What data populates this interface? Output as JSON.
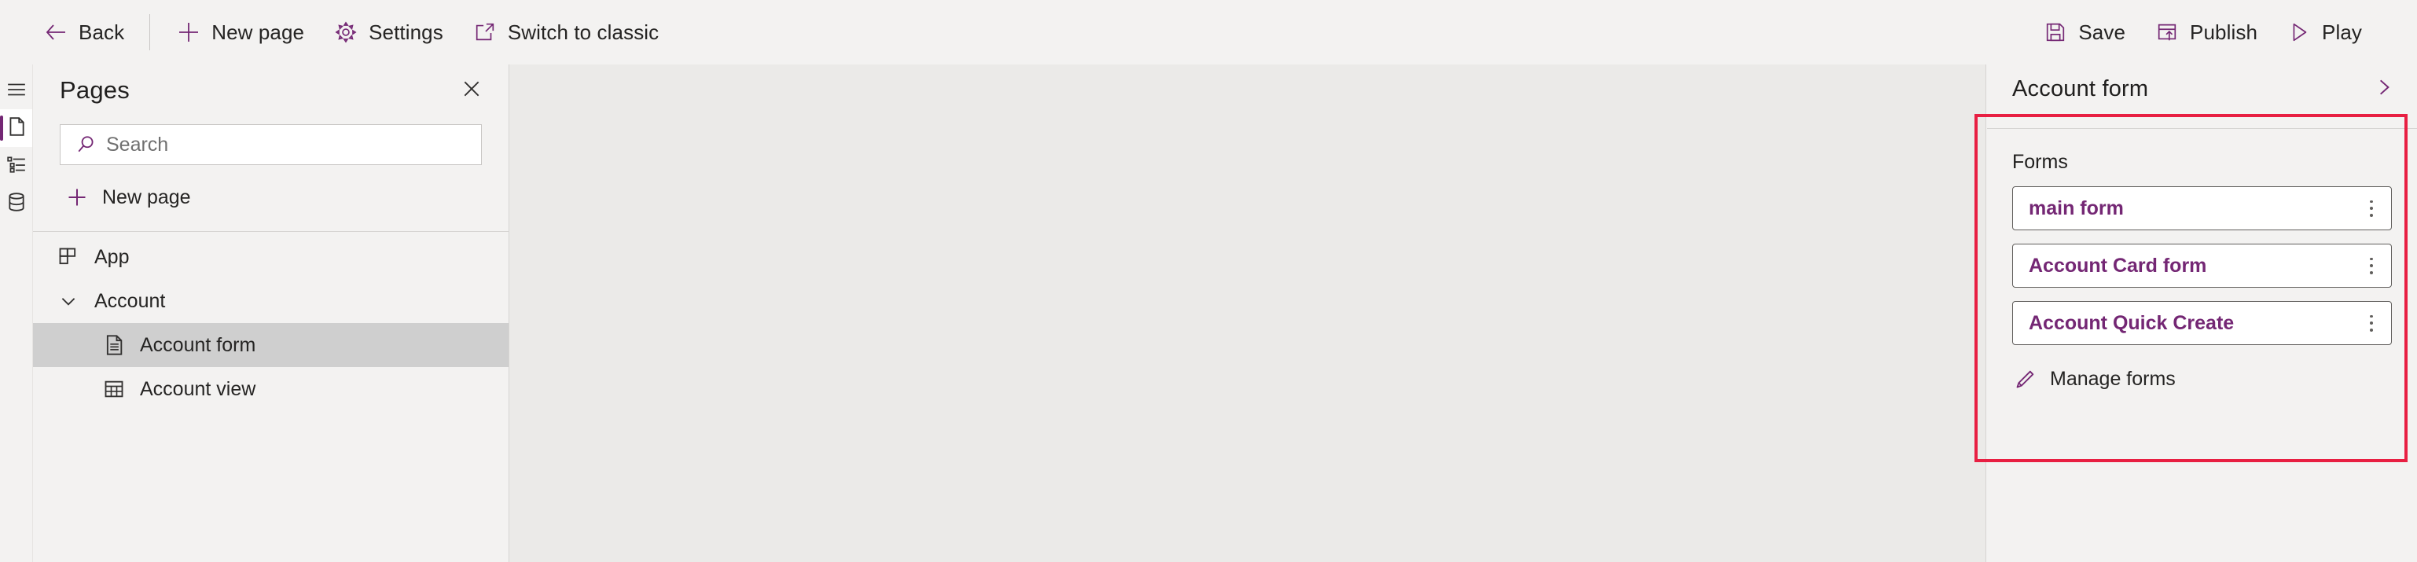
{
  "commandbar": {
    "left_items": [
      {
        "label": "Back",
        "icon": "arrow-left-icon"
      },
      {
        "label": "New page",
        "icon": "plus-icon"
      },
      {
        "label": "Settings",
        "icon": "gear-icon"
      },
      {
        "label": "Switch to classic",
        "icon": "open-external-icon"
      }
    ],
    "right_items": [
      {
        "label": "Save",
        "icon": "save-icon"
      },
      {
        "label": "Publish",
        "icon": "publish-icon"
      },
      {
        "label": "Play",
        "icon": "play-icon"
      }
    ]
  },
  "rail": {
    "items": [
      {
        "name": "hamburger-menu",
        "icon": "hamburger-icon",
        "active": false
      },
      {
        "name": "pages",
        "icon": "page-icon",
        "active": true
      },
      {
        "name": "navigation",
        "icon": "tree-list-icon",
        "active": false
      },
      {
        "name": "data",
        "icon": "database-icon",
        "active": false
      }
    ]
  },
  "pages_panel": {
    "title": "Pages",
    "close_icon": "close-icon",
    "search": {
      "placeholder": "Search",
      "value": "",
      "icon": "search-icon"
    },
    "new_page": {
      "label": "New page",
      "icon": "plus-icon"
    },
    "tree": [
      {
        "label": "App",
        "icon": "app-grid-icon",
        "level": 1,
        "expandable": false,
        "selected": false
      },
      {
        "label": "Account",
        "icon": "chevron-down-icon",
        "level": 1,
        "expandable": true,
        "expanded": true,
        "selected": false
      },
      {
        "label": "Account form",
        "icon": "form-document-icon",
        "level": 2,
        "expandable": false,
        "selected": true
      },
      {
        "label": "Account view",
        "icon": "table-grid-icon",
        "level": 2,
        "expandable": false,
        "selected": false
      }
    ]
  },
  "right_panel": {
    "title": "Account form",
    "collapse_icon": "chevron-right-icon",
    "section_label": "Forms",
    "forms": [
      {
        "label": "main form",
        "menu_icon": "more-vertical-icon"
      },
      {
        "label": "Account Card form",
        "menu_icon": "more-vertical-icon"
      },
      {
        "label": "Account Quick Create",
        "menu_icon": "more-vertical-icon"
      }
    ],
    "manage_forms": {
      "label": "Manage forms",
      "icon": "pencil-icon"
    }
  },
  "colors": {
    "accent_purple": "#742774",
    "annotation_red": "#e81f42",
    "panel_bg": "#f3f2f1",
    "canvas_bg": "#ebeae8",
    "selected_row": "#cfcfcf"
  }
}
